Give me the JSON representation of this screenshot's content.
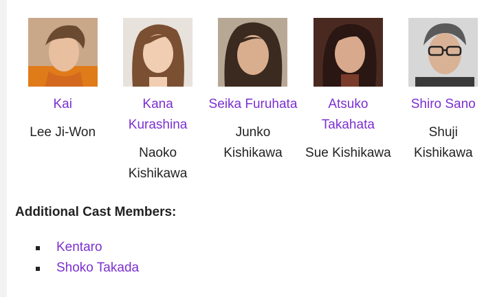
{
  "cast": [
    {
      "actor": "Kai",
      "role": "Lee Ji-Won",
      "photo_icon": "actor-photo"
    },
    {
      "actor": "Kana Kurashina",
      "role": "Naoko Kishikawa",
      "photo_icon": "actor-photo"
    },
    {
      "actor": "Seika Furuhata",
      "role": "Junko Kishikawa",
      "photo_icon": "actor-photo"
    },
    {
      "actor": "Atsuko Takahata",
      "role": "Sue Kishikawa",
      "photo_icon": "actor-photo"
    },
    {
      "actor": "Shiro Sano",
      "role": "Shuji Kishikawa",
      "photo_icon": "actor-photo"
    }
  ],
  "additional": {
    "title": "Additional Cast Members:",
    "members": [
      "Kentaro",
      "Shoko Takada"
    ]
  },
  "colors": {
    "link": "#7b2fd0",
    "text": "#222222"
  }
}
